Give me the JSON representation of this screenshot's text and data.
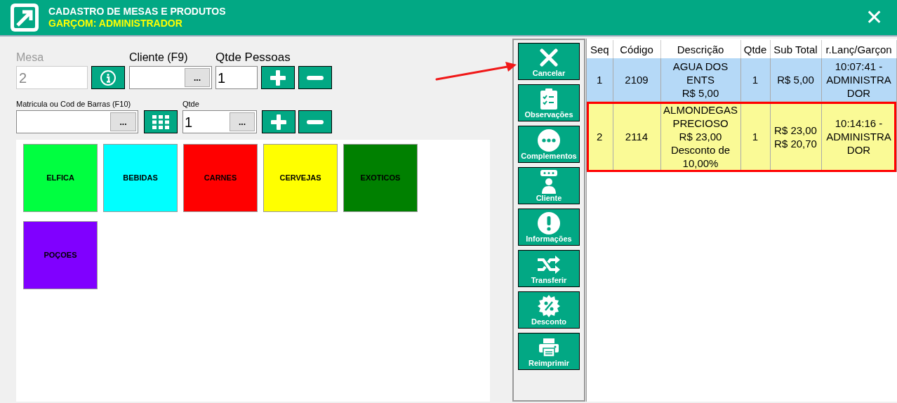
{
  "window": {
    "title": "CADASTRO DE MESAS E PRODUTOS",
    "subtitle": "GARÇOM: ADMINISTRADOR",
    "close": "✕"
  },
  "form": {
    "mesa": {
      "label": "Mesa",
      "value": "2",
      "disabled": true
    },
    "cliente": {
      "label": "Cliente (F9)",
      "button": "..."
    },
    "pessoas": {
      "label": "Qtde Pessoas",
      "value": "1"
    },
    "matricula": {
      "label": "Matricula ou Cod de Barras (F10)",
      "button": "..."
    },
    "qtde": {
      "label": "Qtde",
      "value": "1",
      "button": "..."
    }
  },
  "categories": [
    {
      "label": "ELFICA",
      "color": "#00ff40"
    },
    {
      "label": "BEBIDAS",
      "color": "#00ffff"
    },
    {
      "label": "CARNES",
      "color": "#ff0000"
    },
    {
      "label": "CERVEJAS",
      "color": "#ffff00"
    },
    {
      "label": "EXOTICOS",
      "color": "#008000"
    },
    {
      "label": "POÇOES",
      "color": "#8000ff"
    }
  ],
  "actions": [
    {
      "kind": "cancel",
      "label": "Cancelar"
    },
    {
      "kind": "notes",
      "label": "Observações"
    },
    {
      "kind": "more",
      "label": "Complementos"
    },
    {
      "kind": "client",
      "label": "Cliente"
    },
    {
      "kind": "info",
      "label": "Informações"
    },
    {
      "kind": "transfer",
      "label": "Transferir"
    },
    {
      "kind": "discount",
      "label": "Desconto"
    },
    {
      "kind": "print",
      "label": "Reimprimir"
    }
  ],
  "table": {
    "columns": [
      "Seq",
      "Código",
      "Descrição",
      "Qtde",
      "Sub Total",
      "r.Lanç/Garçon"
    ],
    "rows": [
      {
        "selected": false,
        "cells": [
          "1",
          "2109",
          "AGUA DOS ENTS\nR$ 5,00",
          "1",
          "R$ 5,00",
          "10:07:41 - ADMINISTRA DOR"
        ]
      },
      {
        "selected": true,
        "cells": [
          "2",
          "2114",
          "ALMONDEGAS PRECIOSO\nR$ 23,00\nDesconto de 10,00%",
          "1",
          "R$ 23,00\nR$ 20,70",
          "10:14:16 - ADMINISTRA DOR"
        ]
      }
    ]
  }
}
